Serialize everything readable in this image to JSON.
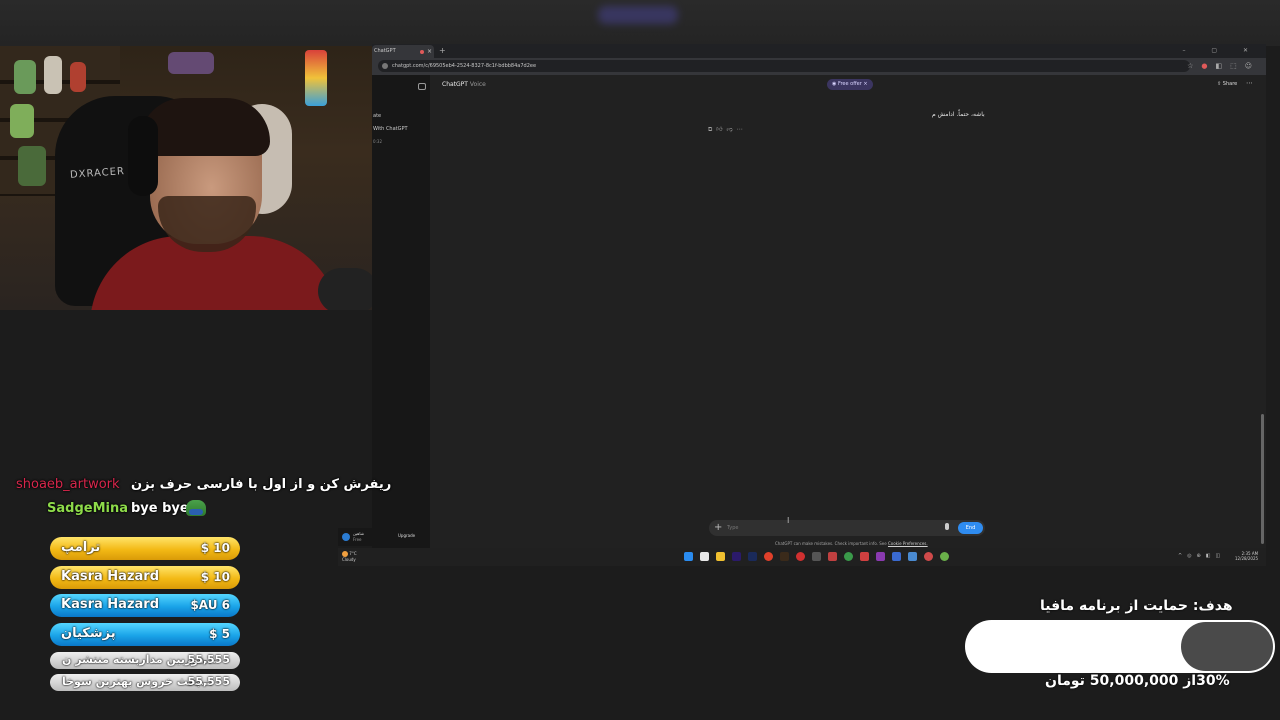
{
  "browser": {
    "tab_title": "ChatGPT",
    "url": "chatgpt.com/c/69505eb4-2524-8327-8c1f-bdbb84a7d2ee",
    "chat_header": {
      "title": "ChatGPT",
      "subtitle": "Voice"
    },
    "free_offer": "Free offer",
    "share": "Share",
    "sidebar": {
      "line1": "ate",
      "line2": "With ChatGPT",
      "line3": "0:32"
    },
    "assistant_message": "باشه، حتماً. ادامش م",
    "composer": {
      "placeholder": "Type",
      "end_label": "End"
    },
    "disclaimer": "ChatGPT can make mistakes. Check important info. See",
    "disclaimer_link": "Cookie Preferences.",
    "user": {
      "name": "شاهین",
      "plan": "Free",
      "upgrade": "Upgrade"
    }
  },
  "taskbar": {
    "weather_temp": "7°C",
    "weather_desc": "Cloudy",
    "time": "2:35 AM",
    "date": "12/28/2025"
  },
  "chat": [
    {
      "user": "shoaeb_artwork",
      "message": "ریفرش کن و از اول با فارسی حرف بزن",
      "user_color": "#d7264b"
    },
    {
      "user": "SadgeMina",
      "message": "bye bye",
      "user_color": "#8edb4a"
    }
  ],
  "donations": [
    {
      "name": "ترامپ",
      "amount": "$ 10",
      "style": "gold"
    },
    {
      "name": "Kasra Hazard",
      "amount": "$ 10",
      "style": "gold"
    },
    {
      "name": "Kasra Hazard",
      "amount": "$AU 6",
      "style": "blue"
    },
    {
      "name": "پزشکیان",
      "amount": "$ 5",
      "style": "blue"
    }
  ],
  "subs": [
    {
      "name": "دوربین مداربسته منتشر ن...",
      "amount": "55,555"
    },
    {
      "name": "بحث خروس بهترین سوخا...",
      "amount": "55,555"
    }
  ],
  "goal": {
    "title": "هدف: حمایت از برنامه مافیا",
    "progress_percent": 30,
    "progress_text": "30%از 50,000,000 تومان"
  },
  "webcam": {
    "chair_brand": "DXRACER"
  }
}
